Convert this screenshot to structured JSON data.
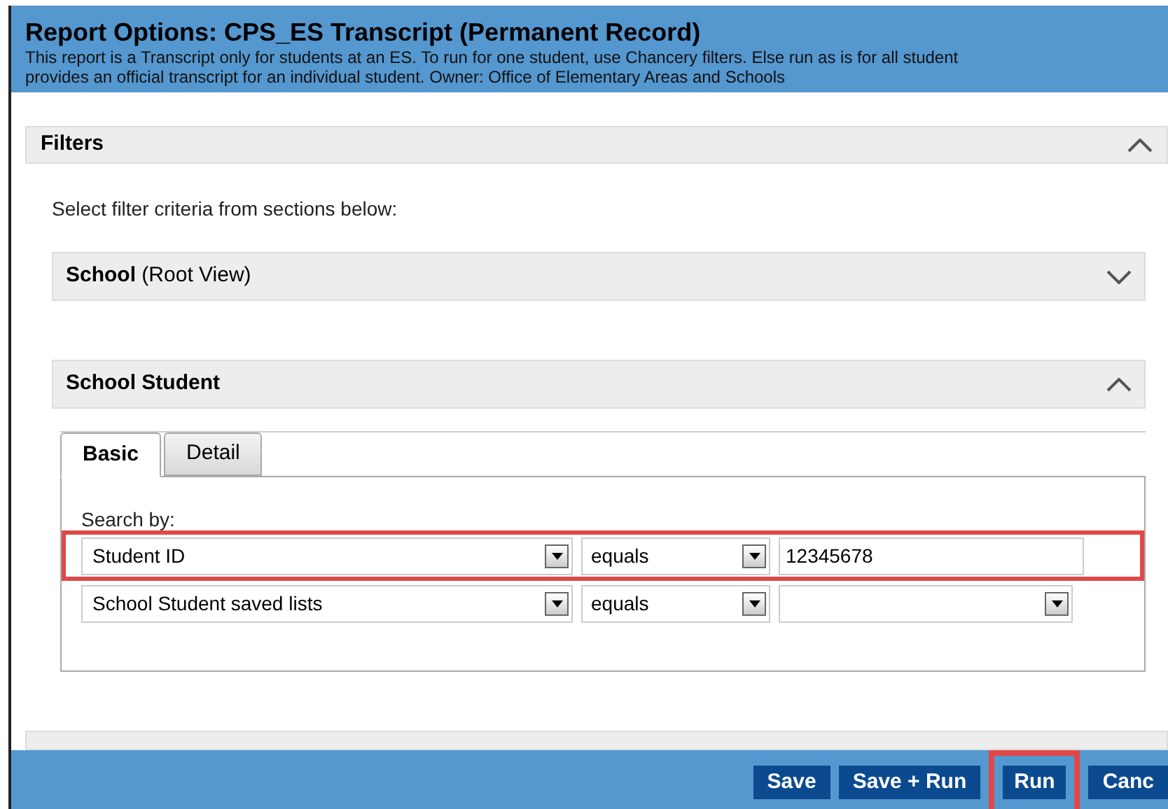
{
  "header": {
    "title": "Report Options: CPS_ES Transcript (Permanent Record)",
    "description_lines": [
      "This report is a Transcript only for students at an ES. To run for one student, use Chancery filters. Else run as is for all student",
      "provides an official transcript for an individual student. Owner: Office of Elementary Areas and Schools"
    ]
  },
  "filters": {
    "title": "Filters",
    "expanded": true,
    "instruction": "Select filter criteria from sections below:",
    "sections": [
      {
        "title": "School",
        "subtitle": "(Root View)",
        "expanded": false
      },
      {
        "title": "School Student",
        "expanded": true,
        "tabs": [
          {
            "label": "Basic",
            "selected": true
          },
          {
            "label": "Detail",
            "selected": false
          }
        ],
        "search_label": "Search by:",
        "rows": [
          {
            "field": "Student ID",
            "operator": "equals",
            "kind": "text",
            "value": "12345678",
            "highlighted": true
          },
          {
            "field": "School Student saved lists",
            "operator": "equals",
            "kind": "select",
            "highlighted": false
          }
        ]
      }
    ]
  },
  "buttons": [
    {
      "label": "Save",
      "highlighted": false
    },
    {
      "label": "Save + Run",
      "highlighted": false
    },
    {
      "label": "Run",
      "highlighted": true
    },
    {
      "label": "Canc",
      "highlighted": false
    }
  ]
}
